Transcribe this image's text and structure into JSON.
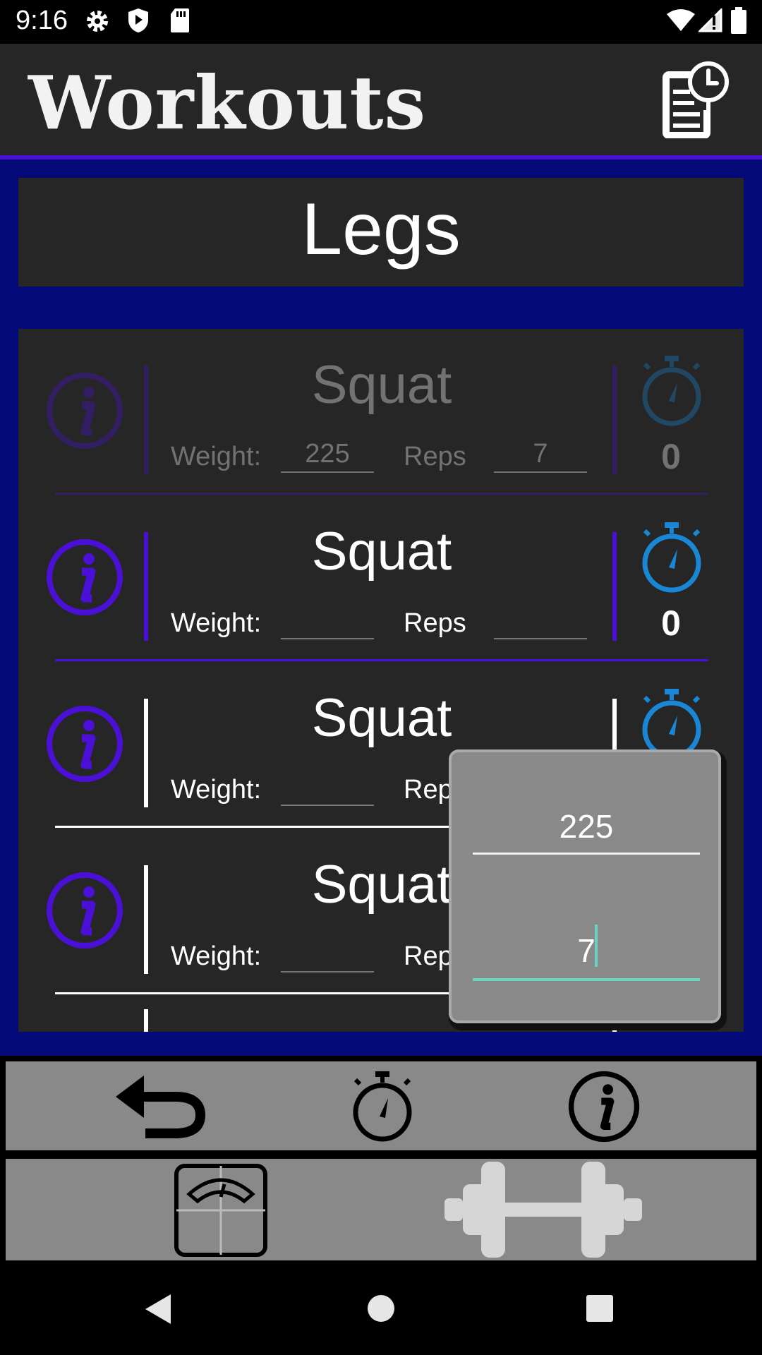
{
  "status_bar": {
    "time": "9:16",
    "left_icons": [
      "settings-gear-icon",
      "shield-play-icon",
      "sd-card-icon"
    ],
    "right_icons": [
      "wifi-icon",
      "cell-signal-icon",
      "battery-icon"
    ]
  },
  "app_bar": {
    "title": "Workouts",
    "action_icon": "history-clipboard-icon"
  },
  "group_title": "Legs",
  "exercises": [
    {
      "name": "Squat",
      "weight_label": "Weight:",
      "weight_value": "225",
      "reps_label": "Reps",
      "reps_value": "7",
      "timer_count": "0",
      "state": "dimmed"
    },
    {
      "name": "Squat",
      "weight_label": "Weight:",
      "weight_value": "",
      "reps_label": "Reps",
      "reps_value": "",
      "timer_count": "0",
      "state": "active"
    },
    {
      "name": "Squat",
      "weight_label": "Weight:",
      "weight_value": "",
      "reps_label": "Reps",
      "reps_value": "",
      "timer_count": "",
      "state": "normal"
    },
    {
      "name": "Squat",
      "weight_label": "Weight:",
      "weight_value": "",
      "reps_label": "Reps",
      "reps_value": "",
      "timer_count": "",
      "state": "normal"
    }
  ],
  "popup": {
    "weight_input": "225",
    "reps_input": "7"
  },
  "bottom_toolbar": [
    "undo-icon",
    "stopwatch-icon",
    "info-icon"
  ],
  "bottom_nav": [
    "scale-icon",
    "dumbbell-icon"
  ],
  "system_nav": [
    "back-icon",
    "home-icon",
    "recents-icon"
  ],
  "colors": {
    "accent_purple": "#4b10d8",
    "timer_blue": "#1a86d6",
    "main_bg": "#030a78",
    "card_bg": "#262626",
    "bar_gray": "#898989",
    "teal_cursor": "#6ad3c4"
  }
}
